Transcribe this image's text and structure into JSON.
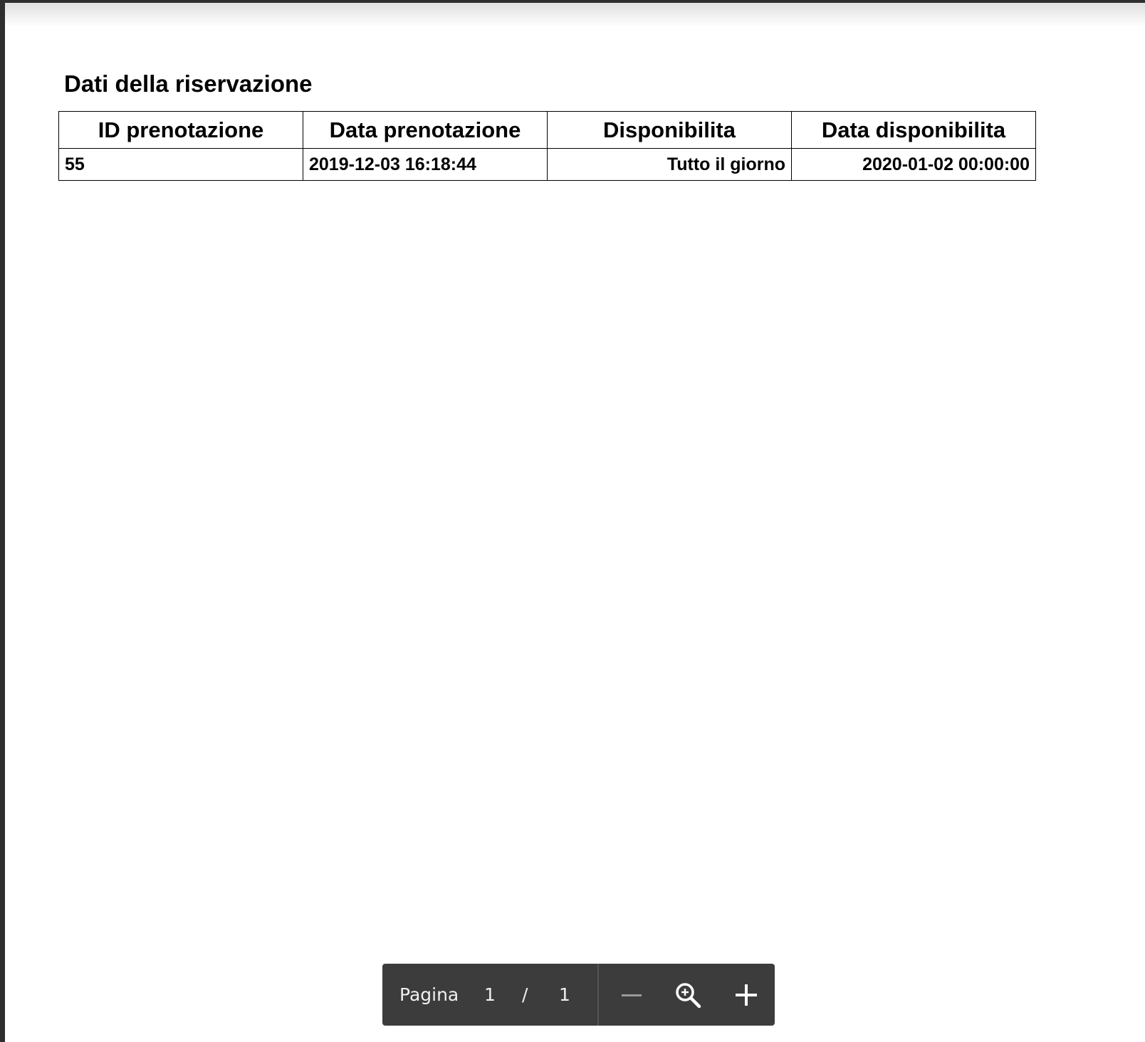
{
  "document": {
    "title": "Dati della riservazione"
  },
  "table": {
    "headers": [
      "ID prenotazione",
      "Data prenotazione",
      "Disponibilita",
      "Data disponibilita"
    ],
    "rows": [
      [
        "55",
        "2019-12-03 16:18:44",
        "Tutto il giorno",
        "2020-01-02 00:00:00"
      ]
    ]
  },
  "toolbar": {
    "page_label": "Pagina",
    "current_page": "1",
    "separator": "/",
    "total_pages": "1",
    "zoom_out_icon": "minus-icon",
    "zoom_icon": "zoom-magnifier-icon",
    "zoom_in_icon": "plus-icon"
  },
  "colors": {
    "toolbar_bg": "#3c3c3c",
    "viewer_bg": "#2e2e2e",
    "page_bg": "#ffffff"
  }
}
